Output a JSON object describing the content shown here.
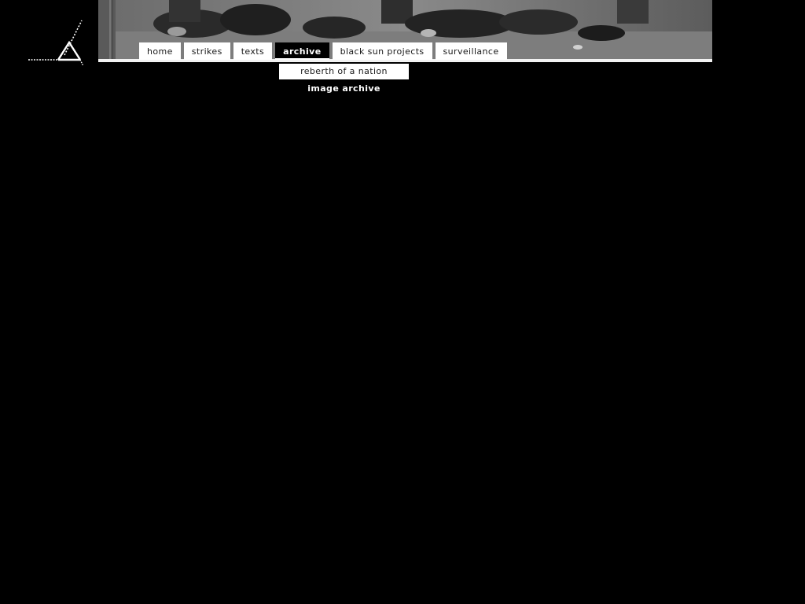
{
  "nav": {
    "tabs": [
      {
        "label": "home",
        "active": false
      },
      {
        "label": "strikes",
        "active": false
      },
      {
        "label": "texts",
        "active": false
      },
      {
        "label": "archive",
        "active": true
      },
      {
        "label": "black sun projects",
        "active": false
      },
      {
        "label": "surveillance",
        "active": false
      }
    ]
  },
  "submenu": {
    "items": [
      {
        "label": "reberth of a nation"
      },
      {
        "label": "image archive"
      }
    ]
  },
  "logo": {
    "icon": "triangle-logo-icon"
  },
  "colors": {
    "background": "#000000",
    "tab_background": "#ffffff",
    "tab_text": "#1a1a1a",
    "active_tab_background": "#000000",
    "active_tab_text": "#ffffff"
  }
}
